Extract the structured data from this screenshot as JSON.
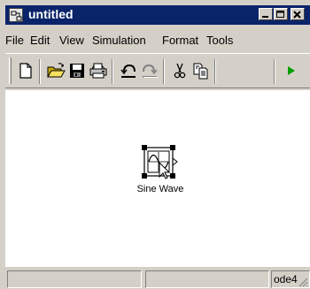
{
  "window": {
    "title": "untitled",
    "icon": "simulink-model-icon",
    "caption_buttons": [
      "minimize-icon",
      "maximize-icon",
      "close-icon"
    ]
  },
  "menubar": {
    "items": [
      {
        "label": "File"
      },
      {
        "label": "Edit"
      },
      {
        "label": "View"
      },
      {
        "label": "Simulation"
      },
      {
        "label": "Format"
      },
      {
        "label": "Tools"
      }
    ]
  },
  "toolbar": {
    "buttons": [
      "new-model-icon",
      "open-folder-icon",
      "save-icon",
      "print-icon",
      "undo-icon",
      "redo-icon",
      "cut-icon",
      "copy-icon",
      "start-simulation-icon"
    ]
  },
  "canvas": {
    "blocks": [
      {
        "label": "Sine Wave",
        "icon": "sine-wave-icon",
        "selected": true
      }
    ]
  },
  "statusbar": {
    "pane1": "",
    "pane2": "",
    "solver": "ode4"
  },
  "colors": {
    "titlebar": "#0a246a",
    "face": "#d4d0c8",
    "canvas": "#ffffff",
    "run_green": "#00a000"
  }
}
